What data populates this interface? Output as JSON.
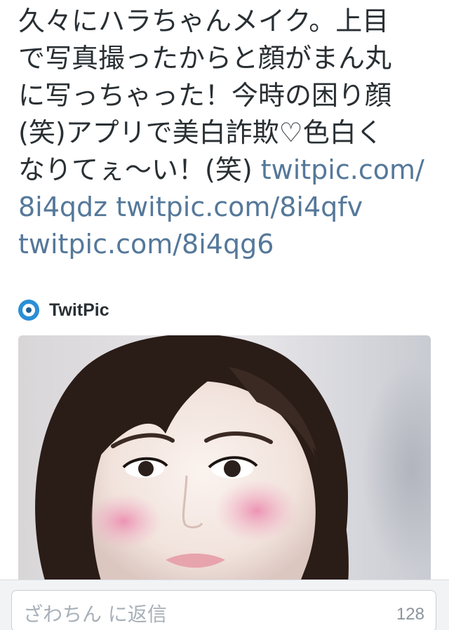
{
  "tweet": {
    "lines": [
      "久々にハラちゃんメイク。上目",
      "で写真撮ったからと顔がまん丸",
      "に写っちゃった！今時の困り顔",
      "(笑)アプリで美白詐欺♡色白く",
      "なりてぇ〜い！(笑) "
    ],
    "links": [
      "twitpic.com/",
      "8i4qdz",
      "twitpic.com/8i4qfv",
      "twitpic.com/8i4qg6"
    ],
    "link_color": "#55789a",
    "text_color": "#292f33"
  },
  "card": {
    "provider": "TwitPic",
    "icon": "twitpic-logo-icon",
    "brand_color": "#2a8fd6"
  },
  "reply": {
    "placeholder": "ざわちん に返信",
    "char_count": "128"
  }
}
